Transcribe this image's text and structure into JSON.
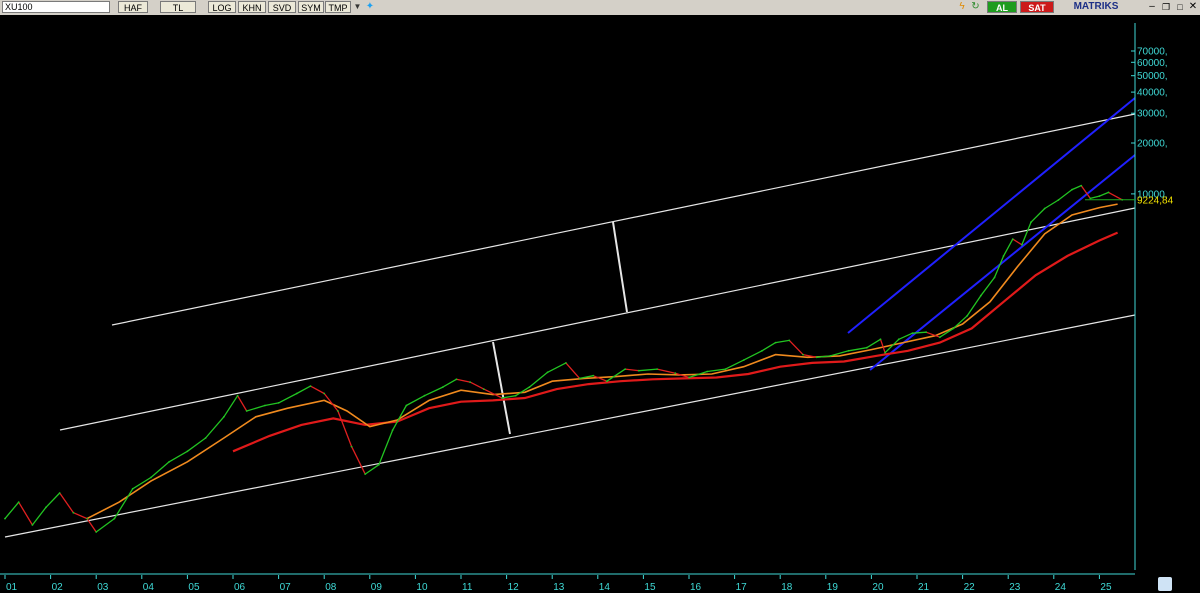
{
  "toolbar": {
    "symbol": "XU100",
    "buttons": [
      "HAF",
      "TL",
      "LOG",
      "KHN",
      "SVD",
      "SYM",
      "TMP"
    ],
    "buy_label": "AL",
    "sell_label": "SAT",
    "brand": "MATRIKS"
  },
  "colors": {
    "background": "#000000",
    "price_up": "#22c422",
    "price_down": "#e02020",
    "ma_short": "#f08a1e",
    "ma_long": "#e01a1a",
    "channel_lines": "#e6e6e6",
    "trend_channel": "#2020ff",
    "axis_text": "#3fd9d6",
    "last_price": "#f0e000"
  },
  "chart_data": {
    "type": "line",
    "scale": "log",
    "grid": false,
    "last_price_label": "9224,84",
    "y_tick_labels": [
      "70000,",
      "60000,",
      "50000,",
      "40000,",
      "30000,",
      "20000,",
      "10000,"
    ],
    "y_ticks": [
      70000,
      60000,
      50000,
      40000,
      30000,
      20000,
      10000
    ],
    "x_tick_labels": [
      "01",
      "02",
      "03",
      "04",
      "05",
      "06",
      "07",
      "08",
      "09",
      "10",
      "11",
      "12",
      "13",
      "14",
      "15",
      "16",
      "17",
      "18",
      "19",
      "20",
      "21",
      "22",
      "23",
      "24",
      "25"
    ],
    "series": [
      {
        "values": [
          [
            2001.0,
            120
          ],
          [
            2001.3,
            150
          ],
          [
            2001.6,
            110
          ],
          [
            2001.9,
            140
          ],
          [
            2002.2,
            170
          ],
          [
            2002.5,
            130
          ],
          [
            2002.8,
            120
          ],
          [
            2003.0,
            100
          ],
          [
            2003.4,
            120
          ],
          [
            2003.8,
            180
          ],
          [
            2004.2,
            210
          ],
          [
            2004.6,
            260
          ],
          [
            2005.0,
            300
          ],
          [
            2005.4,
            360
          ],
          [
            2005.8,
            480
          ],
          [
            2006.1,
            640
          ],
          [
            2006.3,
            520
          ],
          [
            2006.7,
            560
          ],
          [
            2007.0,
            580
          ],
          [
            2007.4,
            660
          ],
          [
            2007.7,
            730
          ],
          [
            2008.0,
            660
          ],
          [
            2008.3,
            520
          ],
          [
            2008.6,
            320
          ],
          [
            2008.9,
            220
          ],
          [
            2009.2,
            250
          ],
          [
            2009.5,
            400
          ],
          [
            2009.8,
            560
          ],
          [
            2010.2,
            640
          ],
          [
            2010.6,
            720
          ],
          [
            2010.9,
            800
          ],
          [
            2011.2,
            770
          ],
          [
            2011.5,
            700
          ],
          [
            2011.9,
            620
          ],
          [
            2012.2,
            640
          ],
          [
            2012.5,
            720
          ],
          [
            2012.9,
            880
          ],
          [
            2013.3,
            1000
          ],
          [
            2013.6,
            810
          ],
          [
            2013.9,
            840
          ],
          [
            2014.2,
            780
          ],
          [
            2014.6,
            920
          ],
          [
            2014.9,
            900
          ],
          [
            2015.3,
            920
          ],
          [
            2015.7,
            870
          ],
          [
            2016.0,
            820
          ],
          [
            2016.4,
            890
          ],
          [
            2016.8,
            920
          ],
          [
            2017.2,
            1040
          ],
          [
            2017.6,
            1180
          ],
          [
            2017.9,
            1320
          ],
          [
            2018.2,
            1360
          ],
          [
            2018.5,
            1120
          ],
          [
            2018.8,
            1080
          ],
          [
            2019.1,
            1100
          ],
          [
            2019.5,
            1180
          ],
          [
            2019.9,
            1230
          ],
          [
            2020.2,
            1380
          ],
          [
            2020.3,
            1150
          ],
          [
            2020.6,
            1380
          ],
          [
            2020.9,
            1500
          ],
          [
            2021.2,
            1520
          ],
          [
            2021.5,
            1420
          ],
          [
            2021.8,
            1600
          ],
          [
            2022.1,
            1900
          ],
          [
            2022.4,
            2500
          ],
          [
            2022.7,
            3200
          ],
          [
            2022.9,
            4300
          ],
          [
            2023.1,
            5400
          ],
          [
            2023.3,
            5000
          ],
          [
            2023.5,
            6800
          ],
          [
            2023.8,
            8200
          ],
          [
            2024.1,
            9200
          ],
          [
            2024.4,
            10600
          ],
          [
            2024.6,
            11200
          ],
          [
            2024.8,
            9400
          ],
          [
            2025.0,
            9700
          ],
          [
            2025.2,
            10200
          ],
          [
            2025.5,
            9225
          ]
        ]
      },
      {
        "values": [
          [
            2002.8,
            120
          ],
          [
            2003.5,
            150
          ],
          [
            2004.2,
            200
          ],
          [
            2005.0,
            260
          ],
          [
            2005.8,
            360
          ],
          [
            2006.5,
            480
          ],
          [
            2007.2,
            540
          ],
          [
            2008.0,
            600
          ],
          [
            2008.5,
            520
          ],
          [
            2009.0,
            420
          ],
          [
            2009.6,
            460
          ],
          [
            2010.3,
            600
          ],
          [
            2011.0,
            690
          ],
          [
            2011.7,
            650
          ],
          [
            2012.4,
            670
          ],
          [
            2013.0,
            780
          ],
          [
            2013.7,
            810
          ],
          [
            2014.4,
            830
          ],
          [
            2015.1,
            860
          ],
          [
            2015.8,
            850
          ],
          [
            2016.5,
            860
          ],
          [
            2017.2,
            950
          ],
          [
            2017.9,
            1120
          ],
          [
            2018.6,
            1080
          ],
          [
            2019.3,
            1100
          ],
          [
            2020.0,
            1200
          ],
          [
            2020.7,
            1320
          ],
          [
            2021.4,
            1450
          ],
          [
            2022.0,
            1700
          ],
          [
            2022.6,
            2300
          ],
          [
            2023.2,
            3700
          ],
          [
            2023.8,
            5800
          ],
          [
            2024.4,
            7500
          ],
          [
            2025.0,
            8300
          ],
          [
            2025.4,
            8700
          ]
        ]
      },
      {
        "values": [
          [
            2006.0,
            300
          ],
          [
            2006.8,
            370
          ],
          [
            2007.5,
            430
          ],
          [
            2008.2,
            470
          ],
          [
            2008.9,
            430
          ],
          [
            2009.6,
            450
          ],
          [
            2010.3,
            540
          ],
          [
            2011.0,
            590
          ],
          [
            2011.7,
            600
          ],
          [
            2012.4,
            620
          ],
          [
            2013.1,
            700
          ],
          [
            2013.8,
            750
          ],
          [
            2014.5,
            780
          ],
          [
            2015.2,
            800
          ],
          [
            2015.9,
            810
          ],
          [
            2016.6,
            820
          ],
          [
            2017.3,
            860
          ],
          [
            2018.0,
            950
          ],
          [
            2018.7,
            1000
          ],
          [
            2019.4,
            1020
          ],
          [
            2020.1,
            1100
          ],
          [
            2020.8,
            1180
          ],
          [
            2021.5,
            1320
          ],
          [
            2022.2,
            1600
          ],
          [
            2022.9,
            2300
          ],
          [
            2023.6,
            3300
          ],
          [
            2024.3,
            4300
          ],
          [
            2025.0,
            5300
          ],
          [
            2025.4,
            5900
          ]
        ]
      }
    ]
  }
}
